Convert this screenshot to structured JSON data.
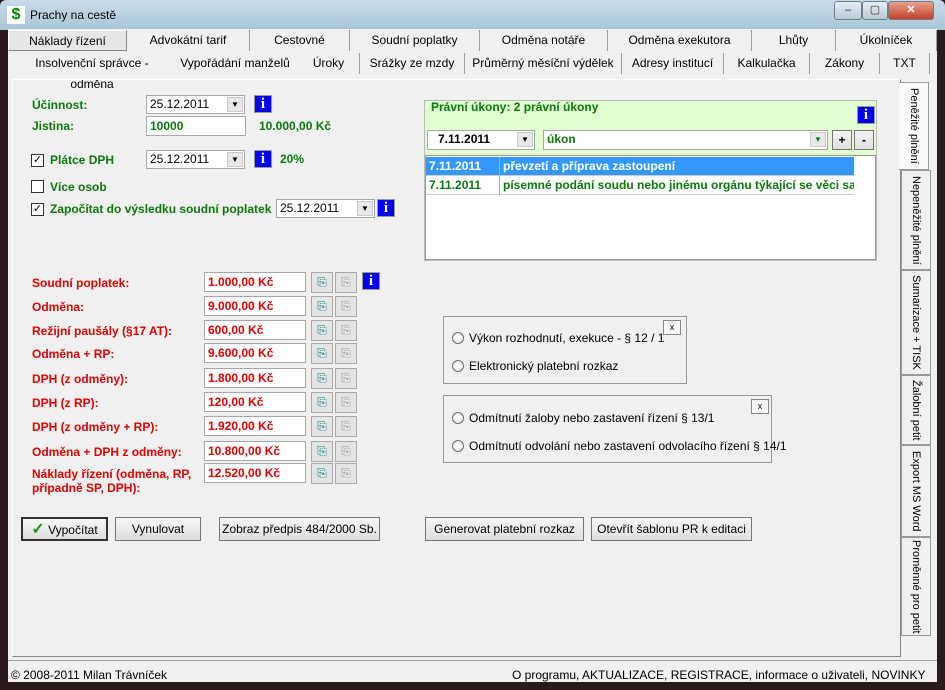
{
  "window": {
    "title": "Prachy na cestě",
    "minimize": "–",
    "maximize": "▢",
    "close": "✕"
  },
  "tabs_row1": [
    "Náklady řízení",
    "Advokátní tarif",
    "Cestovné",
    "Soudní poplatky",
    "Odměna notáře",
    "Odměna exekutora",
    "Lhůty",
    "Úkolníček"
  ],
  "tabs_row2": [
    "Insolvenční správce - odměna",
    "Vypořádání manželů",
    "Úroky",
    "Srážky ze mzdy",
    "Průměrný měsíční výdělek",
    "Adresy institucí",
    "Kalkulačka",
    "Zákony",
    "TXT"
  ],
  "side_tabs": [
    "Peněžité plnění",
    "Nepeněžité plnění",
    "Sumarizace + TISK",
    "Žalobní petit",
    "Export MS Word",
    "Proměnné pro petit"
  ],
  "form": {
    "ucinnost_label": "Účinnost:",
    "ucinnost_date": "25.12.2011",
    "jistina_label": "Jistina:",
    "jistina_value": "10000",
    "jistina_formatted": "10.000,00 Kč",
    "platce_dph_label": "Plátce DPH",
    "platce_dph_checked": true,
    "platce_dph_date": "25.12.2011",
    "dph_rate": "20%",
    "vice_osob_label": "Více osob",
    "vice_osob_checked": false,
    "zapocitat_label": "Započítat do výsledku soudní poplatek",
    "zapocitat_checked": true,
    "zapocitat_date": "25.12.2011",
    "info": "i",
    "check": "✓",
    "arrow": "▼"
  },
  "results": [
    {
      "label": "Soudní poplatek:",
      "value": "1.000,00 Kč"
    },
    {
      "label": "Odměna:",
      "value": "9.000,00 Kč"
    },
    {
      "label": "Režijní paušály (§17 AT):",
      "value": "600,00 Kč"
    },
    {
      "label": "Odměna + RP:",
      "value": "9.600,00 Kč"
    },
    {
      "label": "DPH (z odměny):",
      "value": "1.800,00 Kč"
    },
    {
      "label": "DPH (z RP):",
      "value": "120,00 Kč"
    },
    {
      "label": "DPH (z odměny + RP):",
      "value": "1.920,00 Kč"
    },
    {
      "label": "Odměna + DPH z odměny:",
      "value": "10.800,00 Kč"
    },
    {
      "label": "Náklady řízení (odměna, RP, případně SP, DPH):",
      "value": "12.520,00 Kč"
    }
  ],
  "ukony": {
    "title": "Právní úkony: 2 právní úkony",
    "date": "7.11.2011",
    "ukon": "úkon",
    "add": "+",
    "remove": "-",
    "rows": [
      {
        "date": "7.11.2011",
        "text": "převzetí a příprava zastoupení",
        "selected": true
      },
      {
        "date": "7.11.2011",
        "text": "písemné podání soudu nebo jinému orgánu týkající se věci sa",
        "selected": false
      }
    ]
  },
  "options1": [
    "Výkon rozhodnutí, exekuce - § 12 / 1",
    "Elektronický platební rozkaz"
  ],
  "options2": [
    "Odmítnutí žaloby nebo zastavení řízení § 13/1",
    "Odmítnutí odvolání nebo zastavení odvolacího řízení § 14/1"
  ],
  "close_x": "x",
  "buttons": {
    "vypocitat": "Vypočítat",
    "vynulovat": "Vynulovat",
    "zobraz": "Zobraz předpis 484/2000 Sb.",
    "generovat": "Generovat platební rozkaz",
    "otevrit": "Otevřít šablonu PR k editaci"
  },
  "status": {
    "left": "© 2008-2011 Milan Trávníček",
    "right": "O programu, AKTUALIZACE, REGISTRACE, informace o uživateli, NOVINKY"
  },
  "colors": {
    "label_green": "#0a7a0a",
    "label_red": "#e00000",
    "info_blue": "#0000ee",
    "selected_row": "#3399ff",
    "group_bg": "#e0fcd0"
  }
}
